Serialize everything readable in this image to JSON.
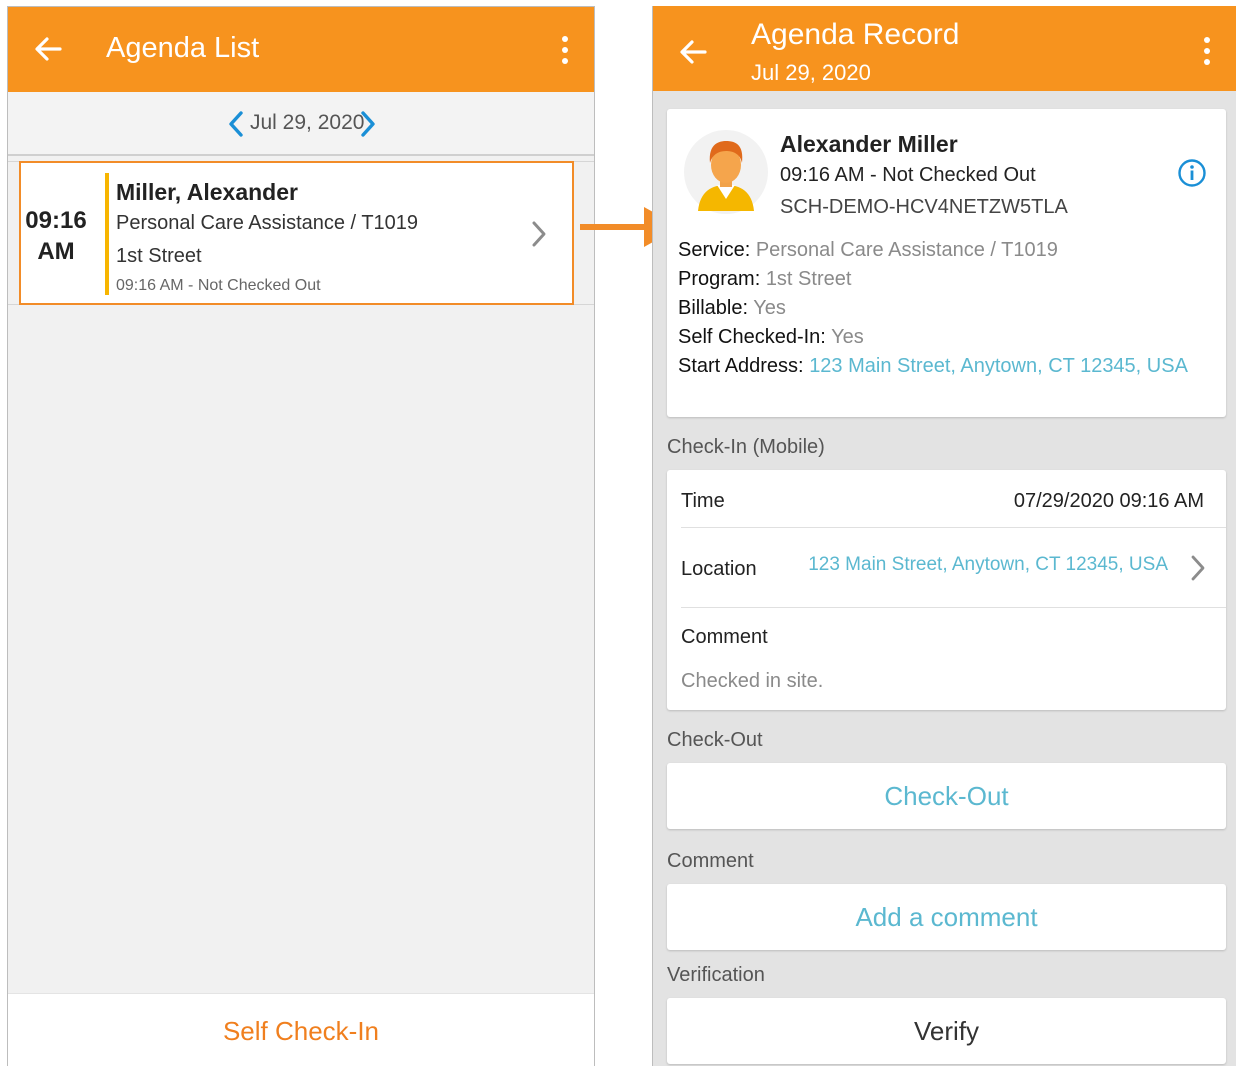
{
  "left_screen": {
    "appbar": {
      "title": "Agenda List"
    },
    "date_nav": {
      "label": "Jul 29, 2020"
    },
    "agenda_item": {
      "time_line1": "09:16",
      "time_line2": "AM",
      "name": "Miller, Alexander",
      "service": "Personal Care Assistance / T1019",
      "program": "1st Street",
      "status": "09:16 AM - Not Checked Out"
    },
    "bottom_action": "Self Check-In"
  },
  "right_screen": {
    "appbar": {
      "title": "Agenda Record",
      "subtitle": "Jul 29, 2020"
    },
    "profile": {
      "name": "Alexander Miller",
      "status": "09:16 AM - Not Checked Out",
      "code": "SCH-DEMO-HCV4NETZW5TLA"
    },
    "details": {
      "service_label": "Service:",
      "service_value": "Personal Care Assistance / T1019",
      "program_label": "Program:",
      "program_value": "1st Street",
      "billable_label": "Billable:",
      "billable_value": "Yes",
      "self_checked_label": "Self Checked-In:",
      "self_checked_value": "Yes",
      "start_address_label": "Start Address:",
      "start_address_value": "123 Main Street, Anytown, CT 12345, USA"
    },
    "checkin": {
      "section_title": "Check-In (Mobile)",
      "time_label": "Time",
      "time_value": "07/29/2020 09:16 AM",
      "location_label": "Location",
      "location_value": "123 Main Street, Anytown, CT 12345, USA",
      "comment_label": "Comment",
      "comment_value": "Checked in site."
    },
    "checkout": {
      "section_title": "Check-Out",
      "button_label": "Check-Out"
    },
    "comment": {
      "section_title": "Comment",
      "button_label": "Add a comment"
    },
    "verification": {
      "section_title": "Verification",
      "button_label": "Verify"
    }
  },
  "colors": {
    "appbar": "#f7931e",
    "highlight_border": "#f28c28",
    "link": "#5bb8d0",
    "accent_bar": "#f7b500",
    "date_arrows": "#1a8fd6"
  }
}
